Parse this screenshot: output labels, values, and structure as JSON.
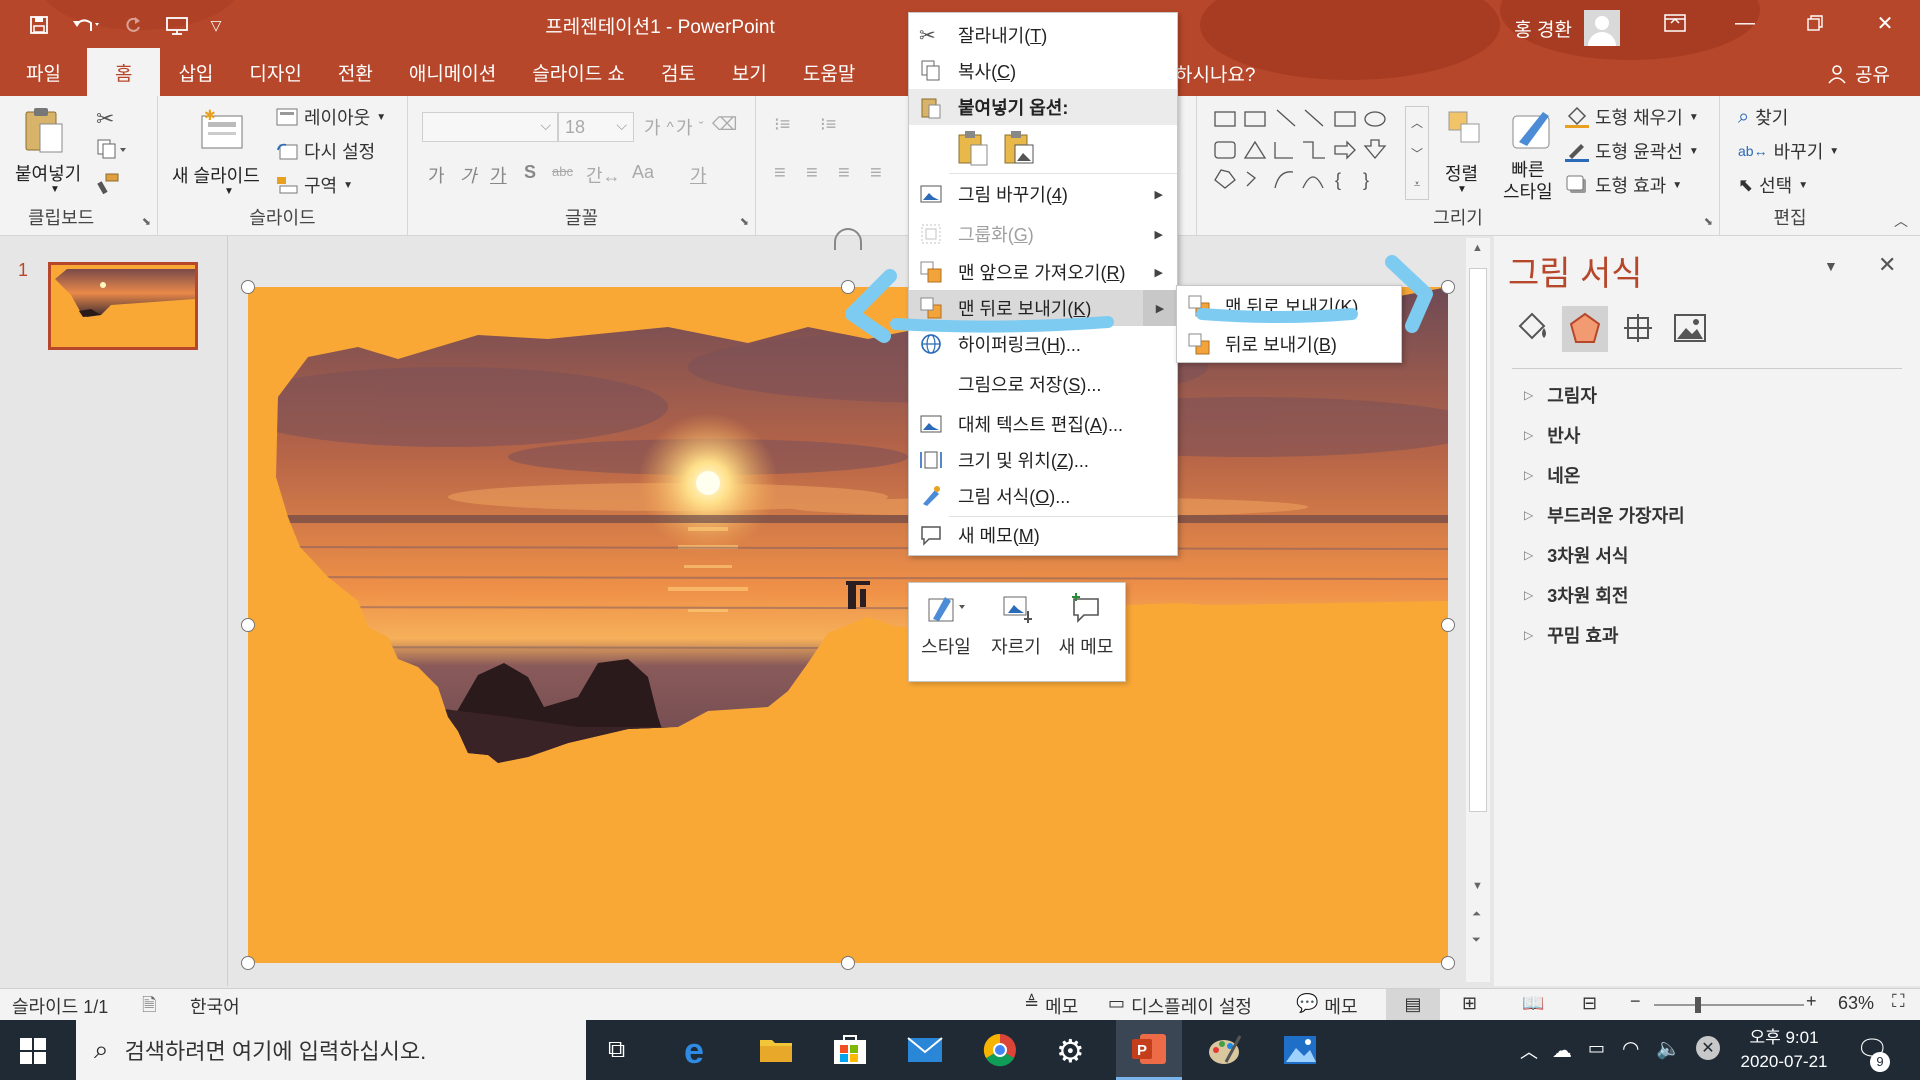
{
  "window": {
    "title": "프레젠테이션1  -  PowerPoint",
    "user_name": "홍 경환"
  },
  "tabs": [
    {
      "label": "파일"
    },
    {
      "label": "홈"
    },
    {
      "label": "삽입"
    },
    {
      "label": "디자인"
    },
    {
      "label": "전환"
    },
    {
      "label": "애니메이션"
    },
    {
      "label": "슬라이드 쇼"
    },
    {
      "label": "검토"
    },
    {
      "label": "보기"
    },
    {
      "label": "도움말"
    }
  ],
  "tellme_partial": "하시나요?",
  "share_label": "공유",
  "ribbon": {
    "clipboard": {
      "group": "클립보드",
      "paste": "붙여넣기"
    },
    "slides": {
      "group": "슬라이드",
      "new_slide": "새 슬라이드",
      "layout": "레이아웃",
      "reset": "다시 설정",
      "section": "구역"
    },
    "font": {
      "group": "글꼴",
      "size": "18",
      "chars": [
        "가",
        "가",
        "가",
        "S",
        "abc",
        "간↔",
        "Aa",
        "가"
      ]
    },
    "drawing": {
      "group": "그리기",
      "arrange": "정렬",
      "quick_styles": "빠른\n스타일",
      "shape_fill": "도형 채우기",
      "shape_outline": "도형 윤곽선",
      "shape_effects": "도형 효과"
    },
    "editing": {
      "group": "편집",
      "find": "찾기",
      "replace": "바꾸기",
      "select": "선택"
    }
  },
  "thumbnail_number": "1",
  "format_panel": {
    "title": "그림 서식",
    "sections": [
      "그림자",
      "반사",
      "네온",
      "부드러운 가장자리",
      "3차원 서식",
      "3차원 회전",
      "꾸밈 효과"
    ]
  },
  "context_menu": {
    "items": [
      {
        "label": "잘라내기",
        "key": "T"
      },
      {
        "label": "복사",
        "key": "C"
      },
      {
        "label": "붙여넣기 옵션:"
      },
      {
        "label": "그림 바꾸기",
        "key": "4"
      },
      {
        "label": "그룹화",
        "key": "G"
      },
      {
        "label": "맨 앞으로 가져오기",
        "key": "R"
      },
      {
        "label": "맨 뒤로 보내기",
        "key": "K"
      },
      {
        "label": "하이퍼링크",
        "key": "H",
        "suffix": "..."
      },
      {
        "label": "그림으로 저장",
        "key": "S",
        "suffix": "..."
      },
      {
        "label": "대체 텍스트 편집",
        "key": "A",
        "suffix": "..."
      },
      {
        "label": "크기 및 위치",
        "key": "Z",
        "suffix": "..."
      },
      {
        "label": "그림 서식",
        "key": "O",
        "suffix": "..."
      },
      {
        "label": "새 메모",
        "key": "M"
      }
    ]
  },
  "submenu": {
    "items": [
      {
        "label": "맨 뒤로 보내기",
        "key": "K"
      },
      {
        "label": "뒤로 보내기",
        "key": "B"
      }
    ]
  },
  "mini_toolbar": {
    "style": "스타일",
    "crop": "자르기",
    "new_comment": "새 메모"
  },
  "statusbar": {
    "slide_info": "슬라이드 1/1",
    "language": "한국어",
    "notes": "메모",
    "display_settings": "디스플레이 설정",
    "comments": "메모",
    "zoom": "63%",
    "zoom_level": 0.63
  },
  "taskbar": {
    "search_placeholder": "검색하려면 여기에 입력하십시오.",
    "time": "오후 9:01",
    "date": "2020-07-21",
    "notification_count": "9"
  },
  "colors": {
    "accent": "#b7472a",
    "slide_bg": "#f9a836",
    "annotation": "#7ecbf2"
  }
}
